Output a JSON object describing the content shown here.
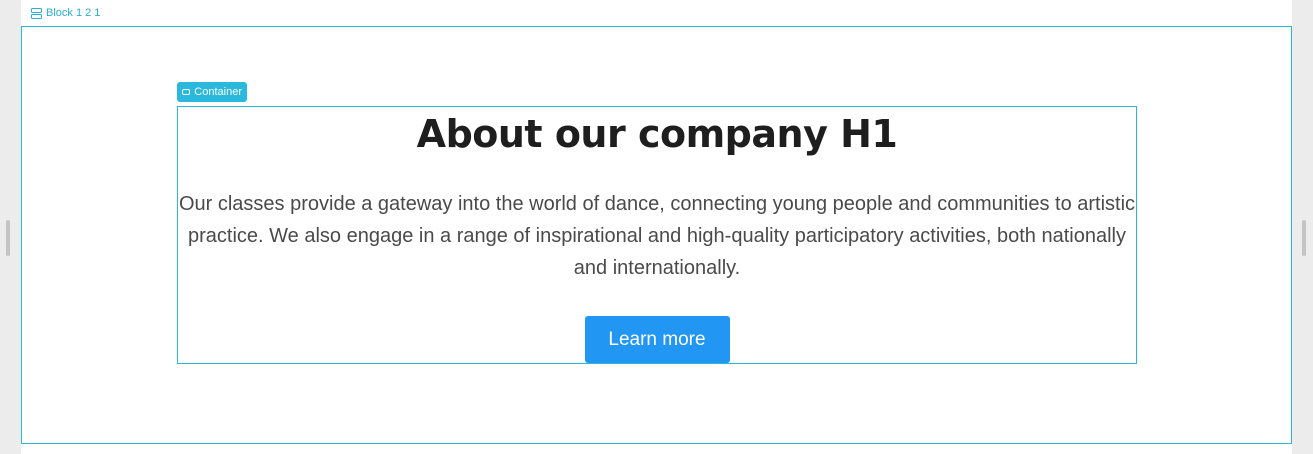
{
  "builder": {
    "block_label": "Block 1 2 1",
    "container_label": "Container",
    "accent_color": "#2ab9dc"
  },
  "content": {
    "heading": "About our company H1",
    "paragraph": "Our classes provide a gateway into the world of dance, connecting young people and communities to artistic practice. We also engage in a range of inspirational and high-quality participatory activities, both nationally and internationally.",
    "button_label": "Learn more",
    "button_color": "#2196f3"
  }
}
